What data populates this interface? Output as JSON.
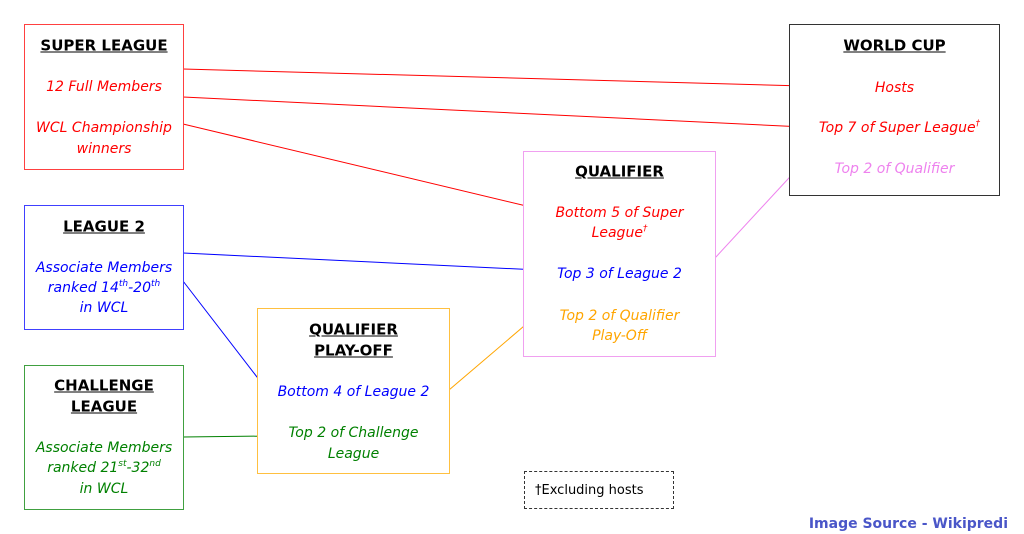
{
  "colors": {
    "super_league": "#ff0000",
    "league2": "#0000ff",
    "challenge": "#008000",
    "playoff": "#ffa500",
    "qualifier": "#ee82ee",
    "world_cup": "#000000"
  },
  "super_league": {
    "title": "SUPER LEAGUE",
    "line1": "12 Full Members",
    "line2a": "WCL Championship",
    "line2b": "winners"
  },
  "league2": {
    "title": "LEAGUE 2",
    "line1": "Associate Members",
    "line2_pre": "ranked 14",
    "sup1": "th",
    "mid": "-20",
    "sup2": "th",
    "line3": "in WCL"
  },
  "challenge": {
    "title_a": "CHALLENGE",
    "title_b": "LEAGUE",
    "line1": "Associate Members",
    "line2_pre": "ranked 21",
    "sup1": "st",
    "mid": "-32",
    "sup2": "nd",
    "line3": "in WCL"
  },
  "playoff": {
    "title_a": "QUALIFIER",
    "title_b": "PLAY-OFF",
    "entry1": "Bottom 4 of League 2",
    "entry2a": "Top 2 of Challenge",
    "entry2b": "League"
  },
  "qualifier": {
    "title": "QUALIFIER",
    "entry1a": "Bottom 5 of Super",
    "entry1b": "League",
    "dagger": "†",
    "entry2": "Top 3 of League 2",
    "entry3a": "Top 2 of Qualifier",
    "entry3b": "Play-Off"
  },
  "world_cup": {
    "title": "WORLD CUP",
    "entry1": "Hosts",
    "entry2": "Top 7 of Super League",
    "dagger": "†",
    "entry3": "Top 2 of Qualifier"
  },
  "footnote": "†Excluding hosts",
  "source": "Image Source - Wikipredi"
}
